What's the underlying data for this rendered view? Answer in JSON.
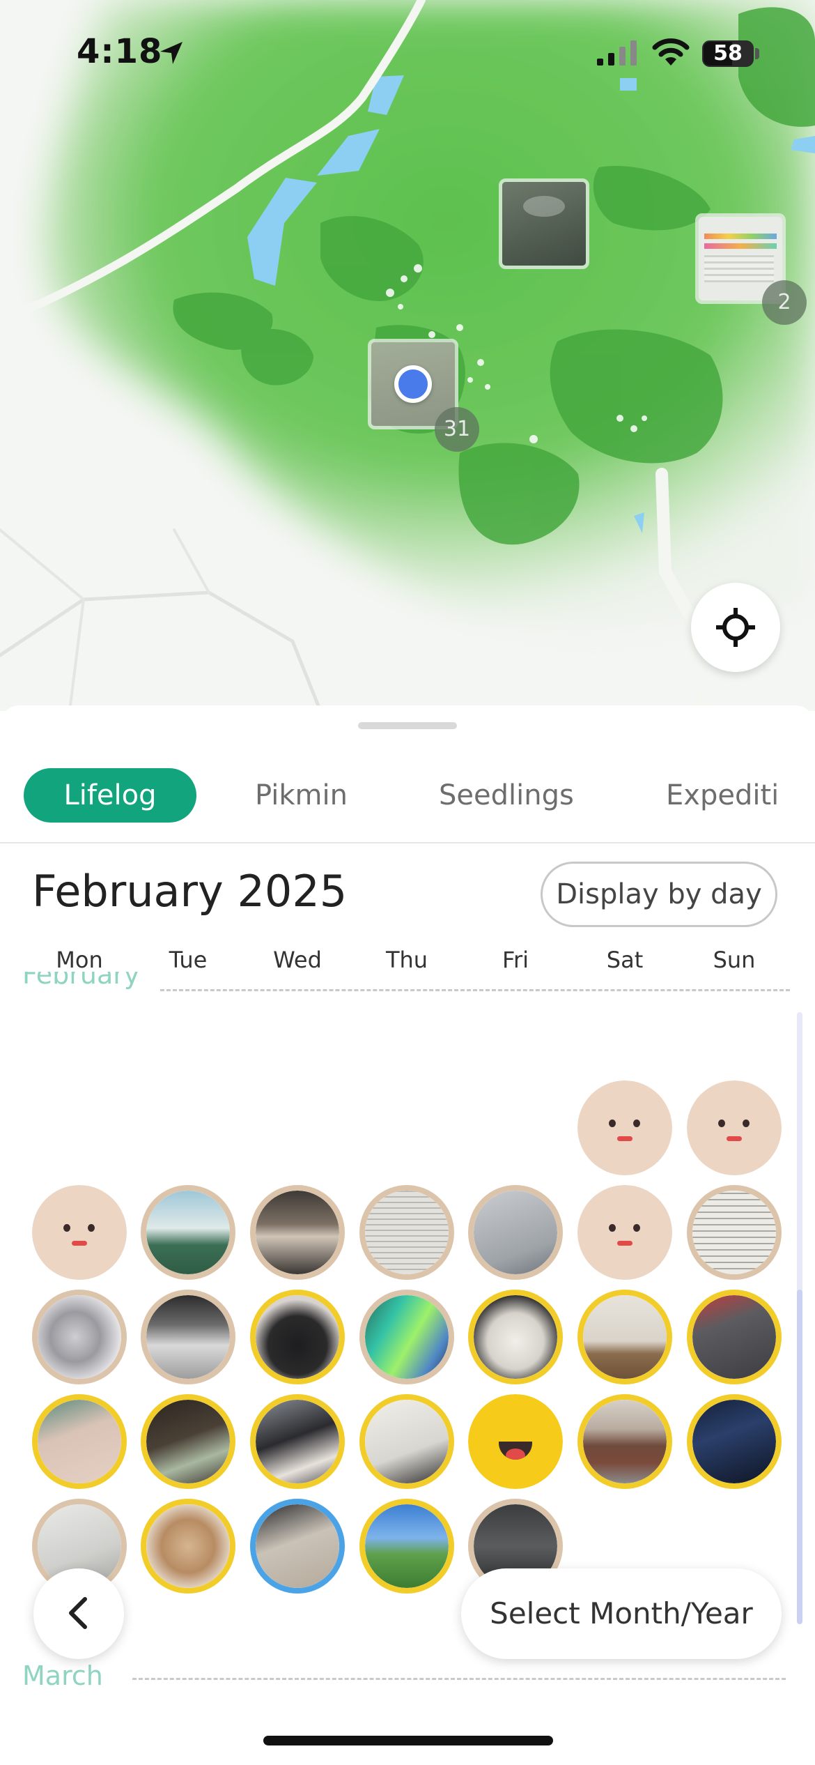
{
  "status_bar": {
    "time": "4:18",
    "battery": "58"
  },
  "map": {
    "pins": [
      {
        "id": "pin-ceiling",
        "count": ""
      },
      {
        "id": "pin-screen",
        "count": "2"
      },
      {
        "id": "pin-user",
        "count": "31"
      }
    ]
  },
  "tabs": [
    {
      "label": "Lifelog",
      "active": true
    },
    {
      "label": "Pikmin",
      "active": false
    },
    {
      "label": "Seedlings",
      "active": false
    },
    {
      "label": "Expediti",
      "active": false
    }
  ],
  "calendar": {
    "title": "February 2025",
    "display_button": "Display by day",
    "weekdays": [
      "Mon",
      "Tue",
      "Wed",
      "Thu",
      "Fri",
      "Sat",
      "Sun"
    ],
    "month_label_top": "February",
    "month_label_bottom": "March",
    "days": [
      {
        "kind": "face",
        "ring": "none"
      },
      {
        "kind": "face",
        "ring": "none"
      },
      {
        "kind": "face",
        "ring": "none"
      },
      {
        "kind": "photo",
        "ring": "tan",
        "icon": "classroom-board-photo"
      },
      {
        "kind": "photo",
        "ring": "tan",
        "icon": "room-photo"
      },
      {
        "kind": "photo",
        "ring": "tan",
        "icon": "paper-notes-photo"
      },
      {
        "kind": "photo",
        "ring": "tan",
        "icon": "printed-page-photo"
      },
      {
        "kind": "face",
        "ring": "none"
      },
      {
        "kind": "photo",
        "ring": "tan",
        "icon": "handwritten-notes-photo"
      },
      {
        "kind": "photo",
        "ring": "tan",
        "icon": "kitten-photo"
      },
      {
        "kind": "photo",
        "ring": "tan",
        "icon": "snowy-street-photo"
      },
      {
        "kind": "photo",
        "ring": "yellow",
        "icon": "person-hair-photo"
      },
      {
        "kind": "photo",
        "ring": "tan",
        "icon": "screen-photo"
      },
      {
        "kind": "photo",
        "ring": "yellow",
        "icon": "white-fabric-photo"
      },
      {
        "kind": "photo",
        "ring": "yellow",
        "icon": "gallery-pedestal-photo"
      },
      {
        "kind": "photo",
        "ring": "yellow",
        "icon": "red-sleeve-photo"
      },
      {
        "kind": "photo",
        "ring": "yellow",
        "icon": "skin-closeup-photo"
      },
      {
        "kind": "photo",
        "ring": "yellow",
        "icon": "laptop-dark-photo"
      },
      {
        "kind": "photo",
        "ring": "yellow",
        "icon": "person-laptop-photo"
      },
      {
        "kind": "photo",
        "ring": "yellow",
        "icon": "sketch-paper-photo"
      },
      {
        "kind": "smiley",
        "ring": "none"
      },
      {
        "kind": "photo",
        "ring": "yellow",
        "icon": "station-platform-photo"
      },
      {
        "kind": "photo",
        "ring": "yellow",
        "icon": "server-rack-photo"
      },
      {
        "kind": "photo",
        "ring": "tan",
        "icon": "document-photo"
      },
      {
        "kind": "photo",
        "ring": "yellow",
        "icon": "iced-drink-photo"
      },
      {
        "kind": "photo",
        "ring": "blue",
        "icon": "workbench-photo"
      },
      {
        "kind": "photo",
        "ring": "yellow",
        "icon": "game-landscape-photo"
      },
      {
        "kind": "photo",
        "ring": "tan",
        "icon": "dark-screen-photo"
      }
    ]
  },
  "buttons": {
    "select_month_year": "Select Month/Year"
  },
  "colors": {
    "accent": "#12a57d",
    "ring_yellow": "#f2cd2a",
    "ring_tan": "#dcc4ab",
    "ring_blue": "#4aa3e6",
    "month_label": "#8fd4c1"
  }
}
